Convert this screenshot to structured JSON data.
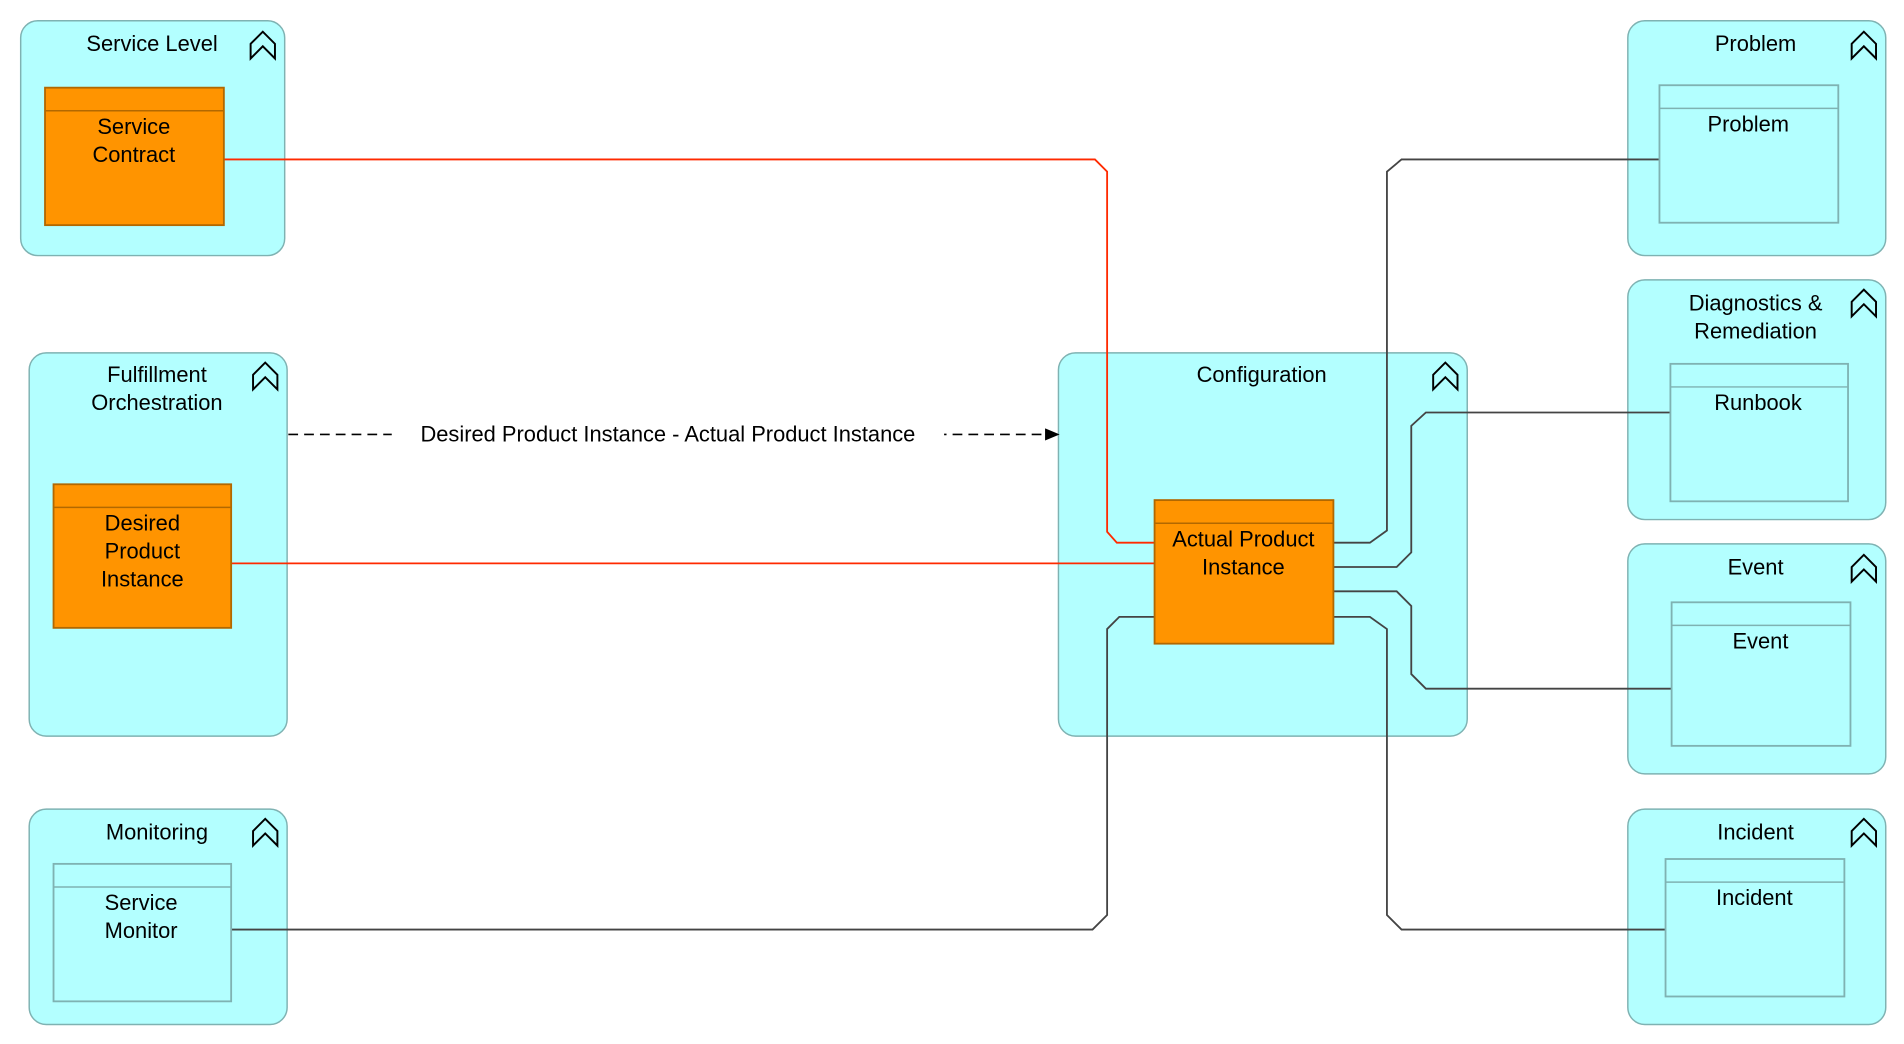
{
  "colors": {
    "group_fill": "#b3ffff",
    "element_orange": "#ff9400",
    "association_red": "#ff2a00",
    "connector_dark": "#444444"
  },
  "groups": {
    "service_level": {
      "title": [
        "Service Level"
      ],
      "icon": "collapse-chevron-icon"
    },
    "fulfillment": {
      "title": [
        "Fulfillment",
        "Orchestration"
      ],
      "icon": "collapse-chevron-icon"
    },
    "monitoring": {
      "title": [
        "Monitoring"
      ],
      "icon": "collapse-chevron-icon"
    },
    "configuration": {
      "title": [
        "Configuration"
      ],
      "icon": "collapse-chevron-icon"
    },
    "problem": {
      "title": [
        "Problem"
      ],
      "icon": "collapse-chevron-icon"
    },
    "diagnostics": {
      "title": [
        "Diagnostics &",
        "Remediation"
      ],
      "icon": "collapse-chevron-icon"
    },
    "event": {
      "title": [
        "Event"
      ],
      "icon": "collapse-chevron-icon"
    },
    "incident": {
      "title": [
        "Incident"
      ],
      "icon": "collapse-chevron-icon"
    }
  },
  "elements": {
    "service_contract": [
      "Service",
      "Contract"
    ],
    "desired_product_instance": [
      "Desired",
      "Product",
      "Instance"
    ],
    "service_monitor": [
      "Service",
      "Monitor"
    ],
    "actual_product_instance": [
      "Actual Product",
      "Instance"
    ],
    "problem": [
      "Problem"
    ],
    "runbook": [
      "Runbook"
    ],
    "event": [
      "Event"
    ],
    "incident": [
      "Incident"
    ]
  },
  "connectors": {
    "desired_to_actual_label": "Desired Product Instance - Actual Product Instance"
  }
}
